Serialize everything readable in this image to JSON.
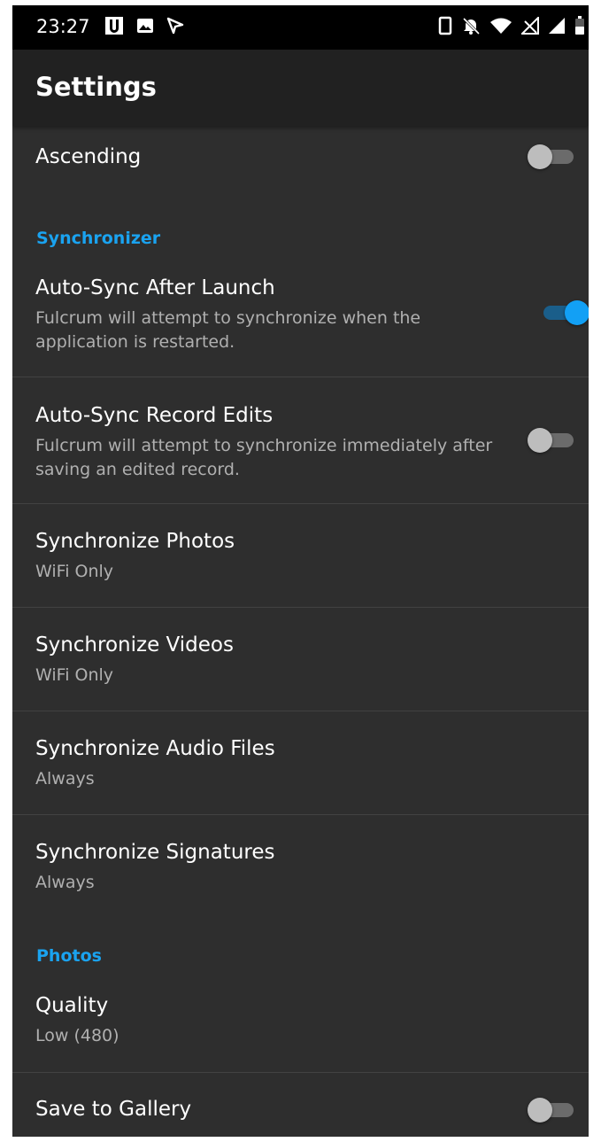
{
  "status_bar": {
    "time": "23:27",
    "left_icons": [
      "u-app-icon",
      "image-icon",
      "navigation-icon"
    ],
    "right_icons": [
      "vibrate-icon",
      "mute-icon",
      "wifi-icon",
      "no-sim-icon",
      "signal-icon",
      "battery-icon"
    ]
  },
  "app_bar": {
    "title": "Settings"
  },
  "colors": {
    "accent": "#1aa3f0",
    "background": "#2e2e2e",
    "app_bar": "#212121"
  },
  "settings": {
    "ascending": {
      "title": "Ascending",
      "enabled": false
    },
    "synchronizer_header": "Synchronizer",
    "auto_sync_launch": {
      "title": "Auto-Sync After Launch",
      "summary": "Fulcrum will attempt to synchronize when the application is restarted.",
      "enabled": true
    },
    "auto_sync_edits": {
      "title": "Auto-Sync Record Edits",
      "summary": "Fulcrum will attempt to synchronize immediately after saving an edited record.",
      "enabled": false
    },
    "sync_photos": {
      "title": "Synchronize Photos",
      "summary": "WiFi Only"
    },
    "sync_videos": {
      "title": "Synchronize Videos",
      "summary": "WiFi Only"
    },
    "sync_audio": {
      "title": "Synchronize Audio Files",
      "summary": "Always"
    },
    "sync_signatures": {
      "title": "Synchronize Signatures",
      "summary": "Always"
    },
    "photos_header": "Photos",
    "quality": {
      "title": "Quality",
      "summary": "Low (480)"
    },
    "save_gallery": {
      "title": "Save to Gallery",
      "enabled": false
    }
  }
}
